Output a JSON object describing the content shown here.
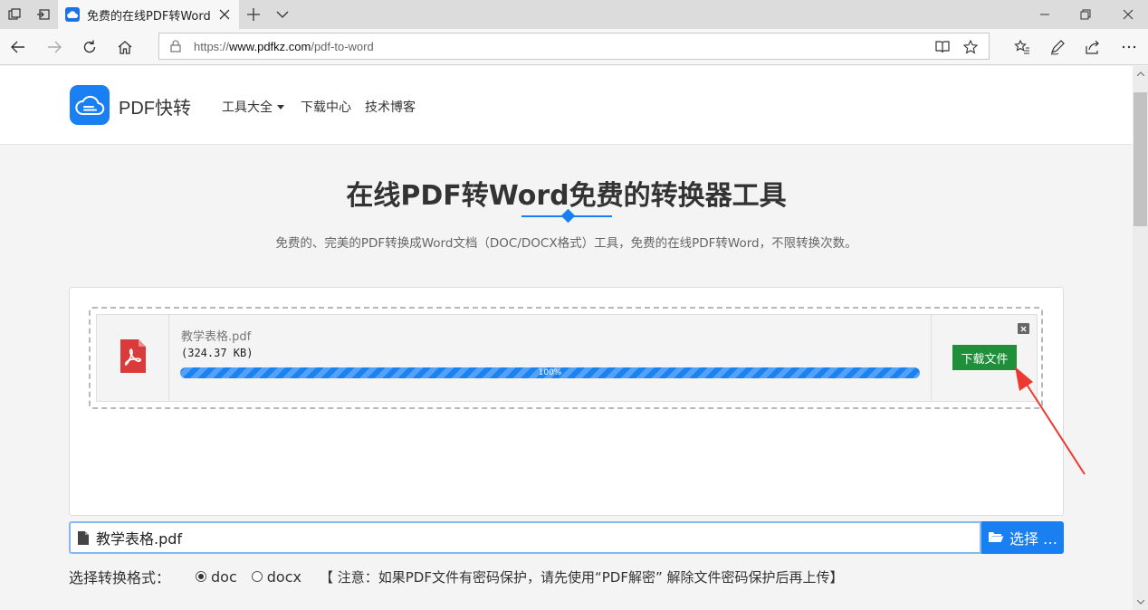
{
  "browser": {
    "tab_title": "免费的在线PDF转Word·",
    "url_prefix": "https://",
    "url_host": "www.pdfkz.com",
    "url_path": "/pdf-to-word"
  },
  "site": {
    "brand": "PDF快转",
    "menu": [
      {
        "label": "工具大全"
      },
      {
        "label": "下载中心"
      },
      {
        "label": "技术博客"
      }
    ]
  },
  "hero": {
    "title": "在线PDF转Word免费的转换器工具",
    "subtitle": "免费的、完美的PDF转换成Word文档（DOC/DOCX格式）工具，免费的在线PDF转Word，不限转换次数。"
  },
  "upload": {
    "file_name": "教学表格.pdf",
    "file_size": "(324.37 KB)",
    "progress": 100,
    "progress_label": "100%",
    "download_label": "下载文件",
    "input_value": "教学表格.pdf",
    "select_label": "选择 …"
  },
  "format": {
    "label": "选择转换格式：",
    "options": [
      {
        "label": "doc",
        "selected": true
      },
      {
        "label": "docx",
        "selected": false
      }
    ],
    "notice": "【 注意：如果PDF文件有密码保护，请先使用“PDF解密” 解除文件密码保护后再上传】"
  },
  "colors": {
    "accent": "#1a7ff0",
    "download_green": "#1f8f3a",
    "annotation_red": "#ec3a32",
    "pdf_red": "#d93a3a"
  }
}
